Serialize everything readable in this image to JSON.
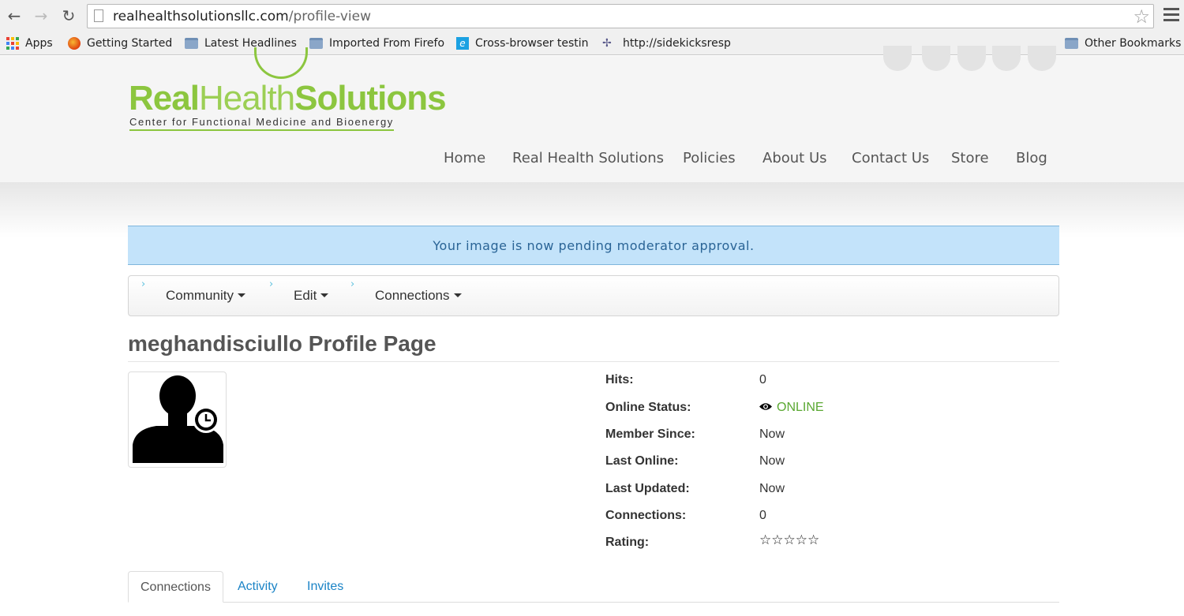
{
  "browser": {
    "url_host": "realhealthsolutionsllc.com",
    "url_path": "/profile-view",
    "bookmarks": [
      {
        "label": "Apps",
        "icon": "apps-grid-icon"
      },
      {
        "label": "Getting Started",
        "icon": "firefox-icon"
      },
      {
        "label": "Latest Headlines",
        "icon": "folder-icon"
      },
      {
        "label": "Imported From Firefo",
        "icon": "folder-icon"
      },
      {
        "label": "Cross-browser testin",
        "icon": "ie-icon"
      },
      {
        "label": "http://sidekicksresp",
        "icon": "bug-icon"
      },
      {
        "label": "Other Bookmarks",
        "icon": "folder-icon"
      }
    ]
  },
  "site": {
    "logo_bold_1": "Real",
    "logo_light": "Health",
    "logo_bold_2": "Solutions",
    "tagline": "Center for Functional Medicine and Bioenergy",
    "brand_color": "#8cc63f",
    "nav": [
      "Home",
      "Real Health Solutions",
      "Policies",
      "About Us",
      "Contact Us",
      "Store",
      "Blog"
    ]
  },
  "alert": {
    "message": "Your image is now pending moderator approval."
  },
  "toolbar": {
    "items": [
      "Community",
      "Edit",
      "Connections"
    ]
  },
  "profile": {
    "title": "meghandisciullo Profile Page",
    "fields": [
      {
        "label": "Hits:",
        "value": "0"
      },
      {
        "label": "Online Status:",
        "value": "ONLINE"
      },
      {
        "label": "Member Since:",
        "value": "Now"
      },
      {
        "label": "Last Online:",
        "value": "Now"
      },
      {
        "label": "Last Updated:",
        "value": "Now"
      },
      {
        "label": "Connections:",
        "value": "0"
      },
      {
        "label": "Rating:",
        "value": "☆☆☆☆☆"
      }
    ]
  },
  "tabs": [
    "Connections",
    "Activity",
    "Invites"
  ]
}
